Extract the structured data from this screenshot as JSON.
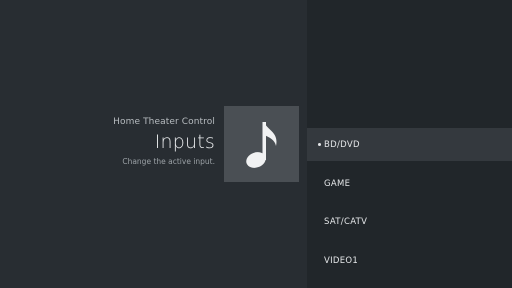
{
  "header": {
    "breadcrumb": "Home Theater Control",
    "title": "Inputs",
    "description": "Change the active input."
  },
  "icon": {
    "name": "music-note-icon"
  },
  "inputs": {
    "items": [
      {
        "label": "BD/DVD",
        "selected": true
      },
      {
        "label": "GAME",
        "selected": false
      },
      {
        "label": "SAT/CATV",
        "selected": false
      },
      {
        "label": "VIDEO1",
        "selected": false
      }
    ]
  },
  "colors": {
    "background": "#282d32",
    "list_background": "#21262a",
    "selected_row": "#34393e",
    "icon_tile": "#4a4f54",
    "text_primary": "#e4e6e8"
  }
}
